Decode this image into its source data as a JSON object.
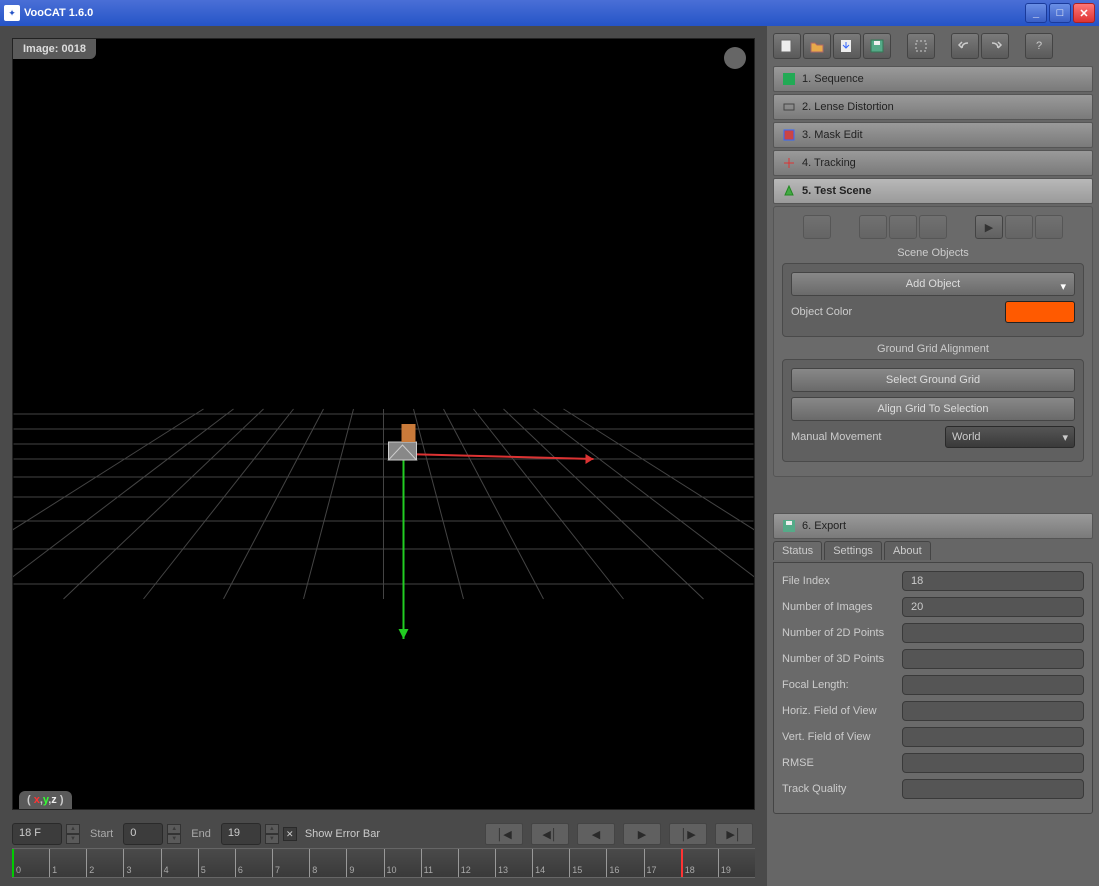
{
  "window": {
    "title": "VooCAT 1.6.0"
  },
  "viewport": {
    "image_label": "Image: 0018",
    "axis_badge": {
      "x": "x",
      "y": "y",
      "z": "z"
    }
  },
  "timeline": {
    "frame": "18 F",
    "start_label": "Start",
    "start": "0",
    "end_label": "End",
    "end": "19",
    "show_error_bar": "Show Error Bar",
    "show_error_checked": true,
    "ticks": [
      "0",
      "1",
      "2",
      "3",
      "4",
      "5",
      "6",
      "7",
      "8",
      "9",
      "10",
      "11",
      "12",
      "13",
      "14",
      "15",
      "16",
      "17",
      "18",
      "19"
    ]
  },
  "toolbar": {
    "new": "new",
    "open": "open",
    "import": "import",
    "save": "save",
    "select": "select",
    "undo": "undo",
    "redo": "redo",
    "help": "help"
  },
  "accordion": {
    "s1": "1. Sequence",
    "s2": "2. Lense Distortion",
    "s3": "3. Mask Edit",
    "s4": "4. Tracking",
    "s5": "5. Test Scene",
    "s6": "6. Export"
  },
  "testscene": {
    "scene_objects_title": "Scene Objects",
    "add_object": "Add Object",
    "object_color_label": "Object Color",
    "object_color": "#ff5a00",
    "grid_title": "Ground Grid Alignment",
    "select_grid": "Select Ground Grid",
    "align_grid": "Align Grid To Selection",
    "manual_move_label": "Manual Movement",
    "manual_move_value": "World"
  },
  "tabs": {
    "status": "Status",
    "settings": "Settings",
    "about": "About"
  },
  "status": {
    "file_index_l": "File Index",
    "file_index": "18",
    "num_images_l": "Number of Images",
    "num_images": "20",
    "num_2d_l": "Number of 2D Points",
    "num_2d": "",
    "num_3d_l": "Number of 3D Points",
    "num_3d": "",
    "focal_l": "Focal Length:",
    "focal": "",
    "hfov_l": "Horiz. Field of View",
    "hfov": "",
    "vfov_l": "Vert. Field of View",
    "vfov": "",
    "rmse_l": "RMSE",
    "rmse": "",
    "track_l": "Track Quality",
    "track": ""
  }
}
